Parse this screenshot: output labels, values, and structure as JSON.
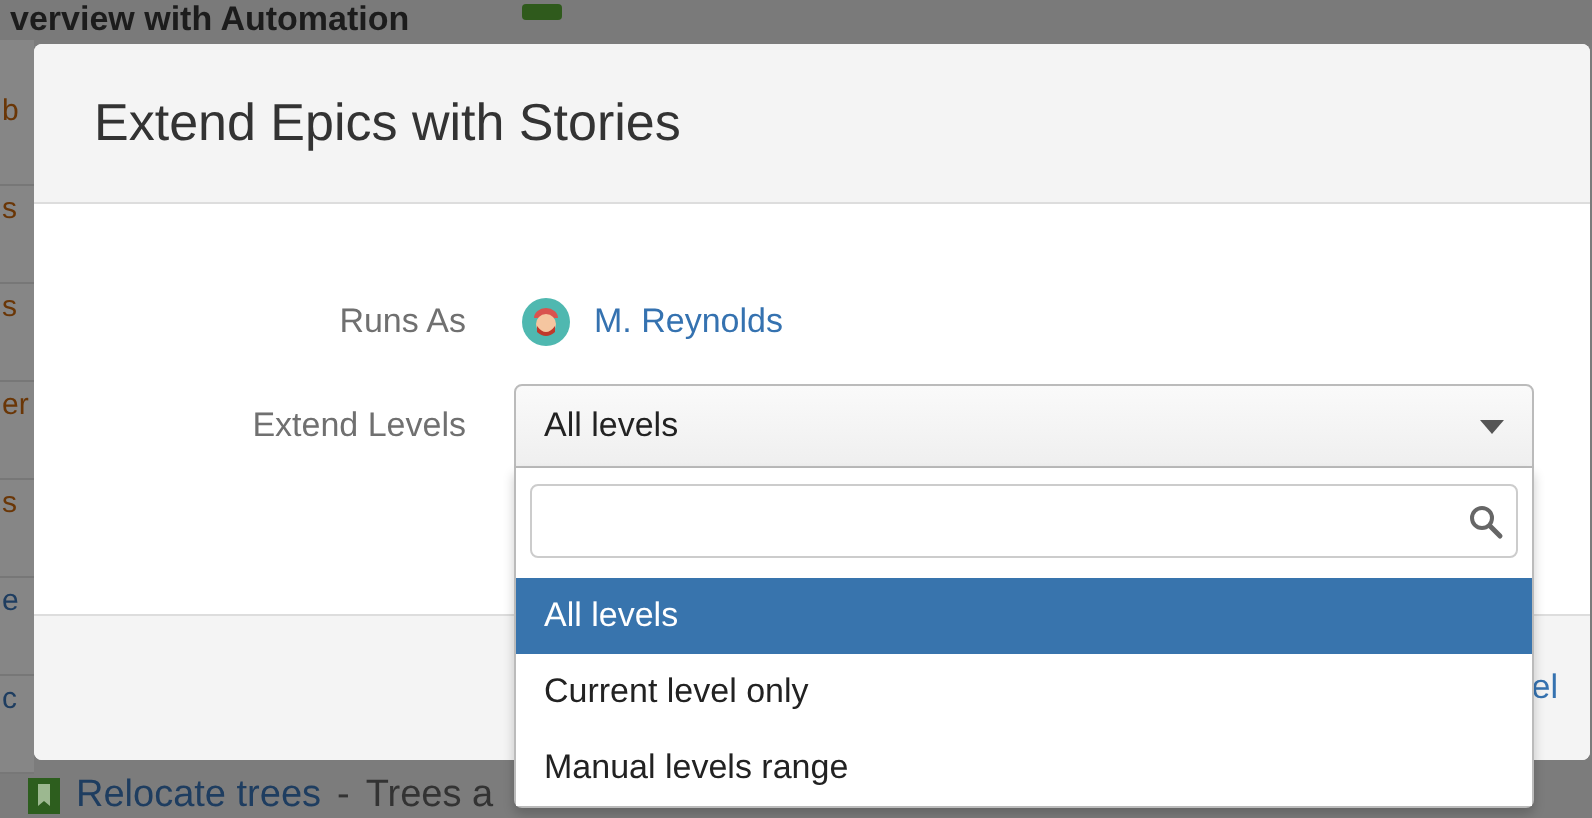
{
  "background_page": {
    "heading": "verview with Automation",
    "row_fragments": [
      {
        "text": "b",
        "kind": "label"
      },
      {
        "text": "s",
        "kind": "label"
      },
      {
        "text": "s",
        "kind": "label"
      },
      {
        "text": "er",
        "kind": "label"
      },
      {
        "text": "s",
        "kind": "label"
      },
      {
        "text": "e",
        "kind": "link"
      },
      {
        "text": "c",
        "kind": "link"
      }
    ],
    "bottom_row": {
      "link": "Relocate trees",
      "separator": "-",
      "description": "Trees a"
    }
  },
  "dialog": {
    "title": "Extend Epics with Stories",
    "fields": [
      {
        "label": "Runs As",
        "kind": "user",
        "value": "M. Reynolds"
      },
      {
        "label": "Extend Levels",
        "kind": "select",
        "value": "All levels",
        "expanded": true
      }
    ],
    "footer_link": "el",
    "dropdown": {
      "options": [
        {
          "label": "All levels",
          "selected": true
        },
        {
          "label": "Current level only",
          "selected": false
        },
        {
          "label": "Manual levels range",
          "selected": false
        }
      ]
    }
  }
}
